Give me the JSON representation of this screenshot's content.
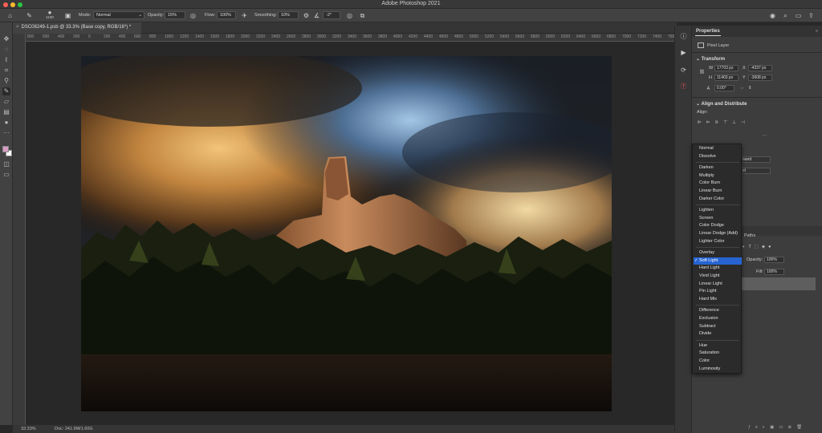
{
  "app": {
    "title": "Adobe Photoshop 2021"
  },
  "options_bar": {
    "brush_size": "1100",
    "mode_label": "Mode:",
    "mode_value": "Normal",
    "opacity_label": "Opacity:",
    "opacity_value": "15%",
    "flow_label": "Flow:",
    "flow_value": "100%",
    "smoothing_label": "Smoothing:",
    "smoothing_value": "10%",
    "angle_value": "-2°"
  },
  "document": {
    "tab_label": "DSC08249-1.psb @ 33.3% (Base copy, RGB/16*) *",
    "zoom": "33.33%",
    "doc_size": "Doc: 241.9M/1.60G"
  },
  "ruler": {
    "ticks": [
      "800",
      "600",
      "400",
      "200",
      "0",
      "200",
      "400",
      "600",
      "800",
      "1000",
      "1200",
      "1400",
      "1600",
      "1800",
      "2000",
      "2200",
      "2400",
      "2600",
      "2800",
      "3000",
      "3200",
      "3400",
      "3600",
      "3800",
      "4000",
      "4200",
      "4400",
      "4600",
      "4800",
      "5000",
      "5200",
      "5400",
      "5600",
      "5800",
      "6000",
      "6200",
      "6400",
      "6600",
      "6800",
      "7000",
      "7200",
      "7400",
      "7600",
      "7800"
    ]
  },
  "properties": {
    "tab": "Properties",
    "kind": "Pixel Layer",
    "transform_title": "Transform",
    "w_label": "W",
    "w_value": "17703 px",
    "x_label": "X",
    "x_value": "-4337 px",
    "h_label": "H",
    "h_value": "11403 px",
    "y_label": "Y",
    "y_value": "-3608 px",
    "angle_value": "0.00°",
    "align_title": "Align and Distribute",
    "align_label": "Align:",
    "partial_1": "ound",
    "partial_2": "ct"
  },
  "layers": {
    "paths_tab": "Paths",
    "opacity_label": "Opacity:",
    "opacity_value": "100%",
    "fill_label": "Fill:",
    "fill_value": "100%"
  },
  "blend_menu": {
    "selected": "Soft Light",
    "groups": [
      [
        "Normal",
        "Dissolve"
      ],
      [
        "Darken",
        "Multiply",
        "Color Burn",
        "Linear Burn",
        "Darker Color"
      ],
      [
        "Lighten",
        "Screen",
        "Color Dodge",
        "Linear Dodge (Add)",
        "Lighter Color"
      ],
      [
        "Overlay",
        "Soft Light",
        "Hard Light",
        "Vivid Light",
        "Linear Light",
        "Pin Light",
        "Hard Mix"
      ],
      [
        "Difference",
        "Exclusion",
        "Subtract",
        "Divide"
      ],
      [
        "Hue",
        "Saturation",
        "Color",
        "Luminosity"
      ]
    ]
  },
  "colors": {
    "accent": "#2764d2",
    "foreground_swatch": "#d79bc4",
    "background_swatch": "#ffffff"
  }
}
